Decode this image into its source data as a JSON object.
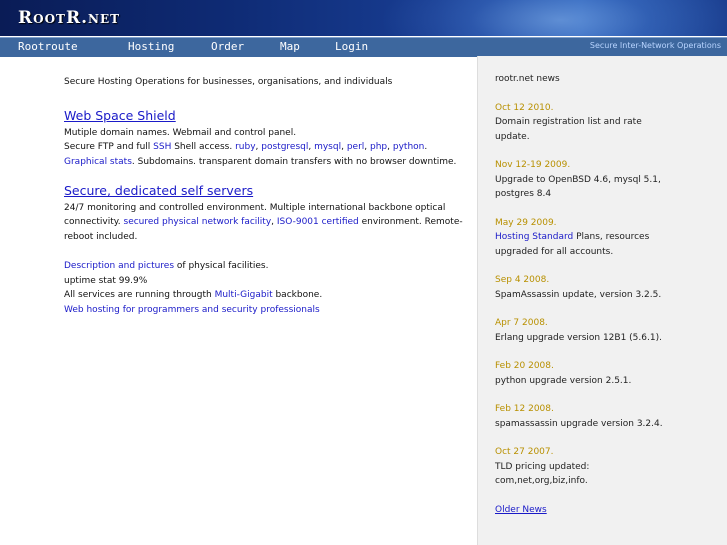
{
  "header": {
    "logo": "RootR.net"
  },
  "nav": {
    "items": [
      "Rootroute",
      "Hosting",
      "Order",
      "Map",
      "Login"
    ],
    "tagline": "Secure Inter-Network Operations"
  },
  "intro": "Secure Hosting Operations for businesses, organisations, and individuals",
  "shield": {
    "title": "Web Space Shield",
    "line1": "Mutiple domain names. Webmail and control panel.",
    "line2_pre": "Secure FTP and full ",
    "ssh": "SSH",
    "line2_mid": " Shell access. ",
    "langs": [
      "ruby",
      "postgresql",
      "mysql",
      "perl",
      "php",
      "python"
    ],
    "graphical": "Graphical stats",
    "line3_rest": ". Subdomains. transparent domain transfers with no browser downtime."
  },
  "servers": {
    "title": "Secure, dedicated self servers",
    "line1": "24/7 monitoring and controlled environment. Multiple international backbone optical",
    "line2_pre": "connectivity. ",
    "facility": "secured physical network facility",
    "iso": "ISO-9001 certified",
    "line2_post": " environment. Remote-",
    "line3": "reboot included."
  },
  "extra": {
    "desc_link": "Description and pictures",
    "desc_rest": " of physical facilities.",
    "uptime": "uptime stat 99.9%",
    "backbone_pre": "All services are running througth ",
    "backbone_link": "Multi-Gigabit",
    "backbone_post": " backbone.",
    "programmers": "Web hosting for programmers and security professionals"
  },
  "news": {
    "title": "rootr.net news",
    "items": [
      {
        "date": "Oct 12 2010.",
        "text": "Domain registration list and rate update."
      },
      {
        "date": "Nov 12-19 2009.",
        "text": "Upgrade to OpenBSD 4.6, mysql 5.1, postgres 8.4"
      },
      {
        "date": "May 29 2009.",
        "link": "Hosting Standard",
        "text": " Plans, resources upgraded for all accounts."
      },
      {
        "date": "Sep 4 2008.",
        "text": "SpamAssassin update, version 3.2.5."
      },
      {
        "date": "Apr 7 2008.",
        "text": "Erlang upgrade version 12B1 (5.6.1)."
      },
      {
        "date": "Feb 20 2008.",
        "text": "python upgrade version 2.5.1."
      },
      {
        "date": "Feb 12 2008.",
        "text": "spamassassin upgrade version 3.2.4."
      },
      {
        "date": "Oct 27 2007.",
        "text": "TLD pricing updated: com,net,org,biz,info."
      }
    ],
    "older": "Older News"
  }
}
